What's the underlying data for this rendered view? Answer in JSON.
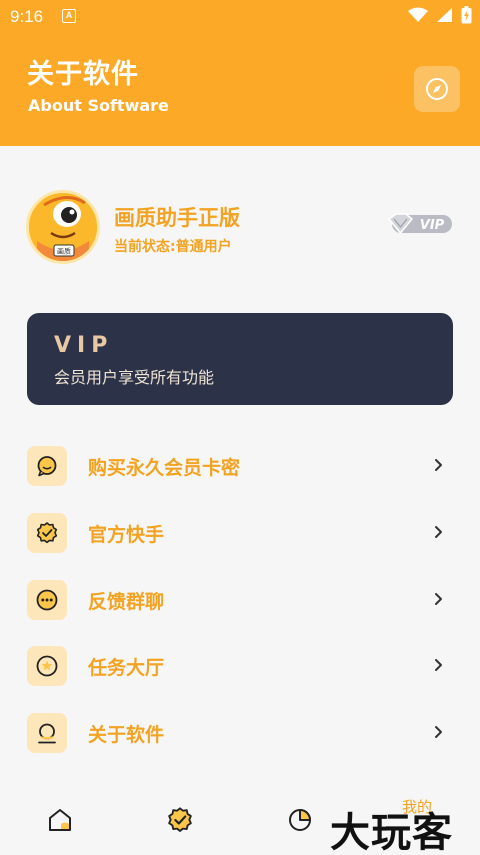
{
  "status_bar": {
    "time": "9:16",
    "notification_glyph": "A"
  },
  "header": {
    "title": "关于软件",
    "subtitle": "About Software",
    "action_icon": "compass-icon"
  },
  "profile": {
    "app_name": "画质助手正版",
    "status": "当前状态:普通用户",
    "badge": "VIP",
    "avatar_text": "画质"
  },
  "vip_card": {
    "title": "VIP",
    "description": "会员用户享受所有功能"
  },
  "menu": [
    {
      "label": "购买永久会员卡密",
      "icon": "chat-icon"
    },
    {
      "label": "官方快手",
      "icon": "badge-check-icon"
    },
    {
      "label": "反馈群聊",
      "icon": "dots-bubble-icon"
    },
    {
      "label": "任务大厅",
      "icon": "star-circle-icon"
    },
    {
      "label": "关于软件",
      "icon": "user-icon"
    }
  ],
  "tabbar": {
    "mine_label": "我的"
  },
  "watermark": "大玩客",
  "colors": {
    "accent": "#fba927",
    "text_accent": "#f3a321",
    "card_bg": "#2c3247",
    "icon_bg": "#fde6b9"
  }
}
